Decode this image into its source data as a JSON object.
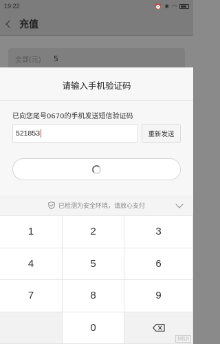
{
  "status_bar": {
    "time": "19:22",
    "battery": ""
  },
  "header": {
    "title": "充值"
  },
  "background": {
    "amount_label": "全部(元)",
    "amount_value": "5"
  },
  "dialog": {
    "title": "请输入手机验证码",
    "hint": "已向您尾号0670的手机发送短信验证码",
    "code_value": "521853",
    "resend_label": "重新发送"
  },
  "keyboard": {
    "security_text": "已检测为安全环境，请放心支付",
    "keys": [
      "1",
      "2",
      "3",
      "4",
      "5",
      "6",
      "7",
      "8",
      "9",
      "",
      "0",
      "delete"
    ]
  },
  "watermark": "MIUI"
}
